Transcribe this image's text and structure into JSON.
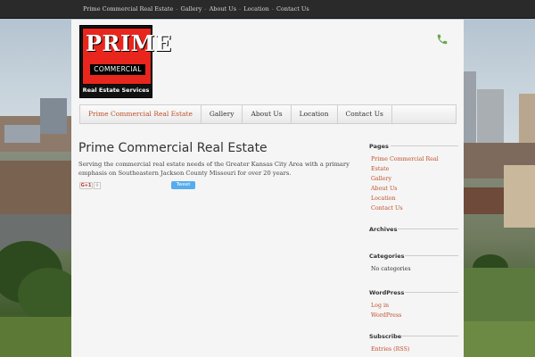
{
  "topbar": {
    "items": [
      "Prime Commercial Real Estate",
      "Gallery",
      "About Us",
      "Location",
      "Contact Us"
    ],
    "separator": "-"
  },
  "logo": {
    "prime": "PRIME",
    "commercial": "COMMERCIAL",
    "services": "Real Estate Services"
  },
  "header": {
    "phone_icon": "phone-icon",
    "phone_color": "#6aa84f"
  },
  "nav": {
    "items": [
      "Prime Commercial Real Estate",
      "Gallery",
      "About Us",
      "Location",
      "Contact Us"
    ],
    "active_index": 0,
    "active_color": "#c0502a"
  },
  "main": {
    "title": "Prime Commercial Real Estate",
    "intro": "Serving the commercial real estate needs of the Greater Kansas City Area with a primary emphasis on Southeastern Jackson County Missouri for over 20 years.",
    "share": {
      "gplus_label": "G+1",
      "gplus_count": "0",
      "tweet_label": "Tweet"
    }
  },
  "sidebar": {
    "pages_title": "Pages",
    "pages": [
      "Prime Commercial Real Estate",
      "Gallery",
      "About Us",
      "Location",
      "Contact Us"
    ],
    "archives_title": "Archives",
    "categories_title": "Categories",
    "categories_empty": "No categories",
    "wordpress_title": "WordPress",
    "wordpress_links": [
      "Log in",
      "WordPress"
    ],
    "subscribe_title": "Subscribe",
    "subscribe_links": [
      "Entries (RSS)"
    ]
  }
}
